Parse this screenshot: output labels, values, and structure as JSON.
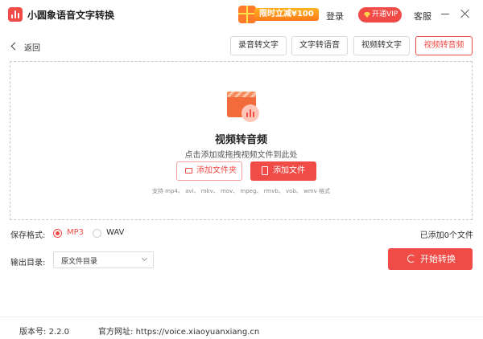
{
  "app": {
    "title": "小圆象语音文字转换"
  },
  "header": {
    "promo_label": "限时立减¥100",
    "login_label": "登录",
    "vip_label": "开通VIP",
    "service_label": "客服"
  },
  "nav": {
    "back_label": "返回",
    "tabs": [
      {
        "label": "录音转文字",
        "active": false
      },
      {
        "label": "文字转语音",
        "active": false
      },
      {
        "label": "视频转文字",
        "active": false
      },
      {
        "label": "视频转音频",
        "active": true
      }
    ]
  },
  "dropzone": {
    "title": "视频转音频",
    "hint": "点击添加或拖拽视频文件到此处",
    "add_folder_label": "添加文件夹",
    "add_file_label": "添加文件",
    "formats": "支持 mp4、 avi、 mkv、 mov、 mpeg、 rmvb、 vob、 wmv 格式"
  },
  "options": {
    "format_label": "保存格式:",
    "formats": [
      {
        "label": "MP3",
        "checked": true
      },
      {
        "label": "WAV",
        "checked": false
      }
    ],
    "added_count": "已添加0个文件",
    "output_label": "输出目录:",
    "output_value": "原文件目录",
    "start_label": "开始转换"
  },
  "footer": {
    "version_label": "版本号:",
    "version": "2.2.0",
    "site_label": "官方网址:",
    "site": "https://voice.xiaoyuanxiang.cn"
  },
  "colors": {
    "accent": "#f04b46",
    "promo": "#ff8c1a",
    "vip_icon": "#ffd24a",
    "border": "#d9d9d9"
  },
  "icons": {
    "app_logo": "audio-wave-icon",
    "promo": "gift-icon",
    "vip": "diamond-icon",
    "back": "chevron-left-icon",
    "media": "video-audio-icon",
    "folder": "folder-add-icon",
    "file": "file-add-icon",
    "start": "refresh-icon"
  }
}
